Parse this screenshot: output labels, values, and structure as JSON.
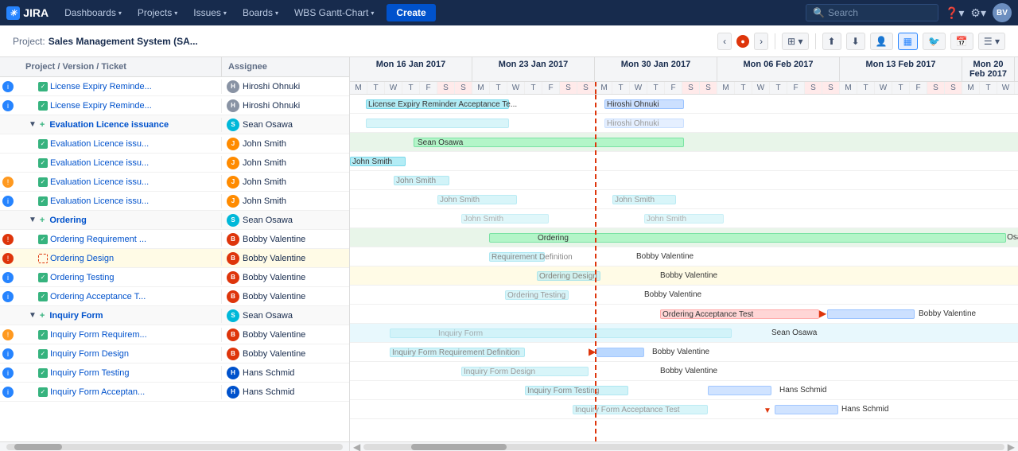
{
  "nav": {
    "logo": "JIRA",
    "menus": [
      "Dashboards",
      "Projects",
      "Issues",
      "Boards",
      "WBS Gantt-Chart"
    ],
    "create_label": "Create",
    "search_placeholder": "Search"
  },
  "subheader": {
    "project_label": "Project:",
    "project_name": "Sales Management System (SA...",
    "nav_prev": "‹",
    "nav_next": "›"
  },
  "columns": {
    "ticket": "Project / Version / Ticket",
    "assignee": "Assignee"
  },
  "weeks": [
    {
      "label": "Mon 16 Jan 2017",
      "days": 7
    },
    {
      "label": "Mon 23 Jan 2017",
      "days": 7
    },
    {
      "label": "Mon 30 Jan 2017",
      "days": 7
    },
    {
      "label": "Mon 06 Feb 2017",
      "days": 7
    },
    {
      "label": "Mon 13 Feb 2017",
      "days": 7
    },
    {
      "label": "Mon 20 Feb 2017",
      "days": 3
    }
  ],
  "days": [
    "M",
    "T",
    "W",
    "T",
    "F",
    "S",
    "S",
    "M",
    "T",
    "W",
    "T",
    "F",
    "S",
    "S",
    "M",
    "T",
    "W",
    "T",
    "F",
    "S",
    "S",
    "M",
    "T",
    "W",
    "T",
    "F",
    "S",
    "S",
    "M",
    "T",
    "W",
    "T",
    "F",
    "S",
    "S",
    "M",
    "T",
    "W"
  ],
  "rows": [
    {
      "id": 1,
      "indent": 2,
      "priority": "info",
      "checkbox": true,
      "name": "License Expiry Reminde...",
      "assignee": "Hiroshi Ohnuki",
      "av": "gray",
      "ticket_type": "T"
    },
    {
      "id": 2,
      "indent": 2,
      "priority": "info",
      "checkbox": true,
      "name": "License Expiry Reminde...",
      "assignee": "Hiroshi Ohnuki",
      "av": "gray",
      "ticket_type": "T"
    },
    {
      "id": 3,
      "indent": 1,
      "priority": null,
      "checkbox": false,
      "section": true,
      "expand": true,
      "name": "Evaluation Licence issuance",
      "assignee": "Sean Osawa",
      "av": "teal",
      "ticket_type": "In"
    },
    {
      "id": 4,
      "indent": 2,
      "priority": null,
      "checkbox": true,
      "name": "Evaluation Licence issu...",
      "assignee": "John Smith",
      "av": "orange",
      "ticket_type": "D"
    },
    {
      "id": 5,
      "indent": 2,
      "priority": null,
      "checkbox": true,
      "name": "Evaluation Licence issu...",
      "assignee": "John Smith",
      "av": "orange",
      "ticket_type": "D"
    },
    {
      "id": 6,
      "indent": 2,
      "priority": "warn",
      "checkbox": true,
      "name": "Evaluation Licence issu...",
      "assignee": "John Smith",
      "av": "orange",
      "ticket_type": "T"
    },
    {
      "id": 7,
      "indent": 2,
      "priority": "info",
      "checkbox": true,
      "name": "Evaluation Licence issu...",
      "assignee": "John Smith",
      "av": "orange",
      "ticket_type": "T"
    },
    {
      "id": 8,
      "indent": 1,
      "priority": null,
      "checkbox": false,
      "section": true,
      "expand": true,
      "name": "Ordering",
      "assignee": "Sean Osawa",
      "av": "teal",
      "ticket_type": "In"
    },
    {
      "id": 9,
      "indent": 2,
      "priority": "err",
      "checkbox": true,
      "name": "Ordering Requirement ...",
      "assignee": "Bobby Valentine",
      "av": "red",
      "ticket_type": "T"
    },
    {
      "id": 10,
      "indent": 2,
      "priority": "err",
      "checkbox": false,
      "highlighted": true,
      "name": "Ordering Design",
      "assignee": "Bobby Valentine",
      "av": "red",
      "ticket_type": "T"
    },
    {
      "id": 11,
      "indent": 2,
      "priority": "info",
      "checkbox": true,
      "name": "Ordering Testing",
      "assignee": "Bobby Valentine",
      "av": "red",
      "ticket_type": "T"
    },
    {
      "id": 12,
      "indent": 2,
      "priority": "info",
      "checkbox": true,
      "name": "Ordering Acceptance T...",
      "assignee": "Bobby Valentine",
      "av": "red",
      "ticket_type": "T"
    },
    {
      "id": 13,
      "indent": 1,
      "priority": null,
      "checkbox": false,
      "section": true,
      "expand": true,
      "name": "Inquiry Form",
      "assignee": "Sean Osawa",
      "av": "teal",
      "ticket_type": "T"
    },
    {
      "id": 14,
      "indent": 2,
      "priority": "warn",
      "checkbox": true,
      "name": "Inquiry Form Requirem...",
      "assignee": "Bobby Valentine",
      "av": "red",
      "ticket_type": "T"
    },
    {
      "id": 15,
      "indent": 2,
      "priority": "info",
      "checkbox": true,
      "name": "Inquiry Form Design",
      "assignee": "Bobby Valentine",
      "av": "red",
      "ticket_type": "T"
    },
    {
      "id": 16,
      "indent": 2,
      "priority": "info",
      "checkbox": true,
      "name": "Inquiry Form Testing",
      "assignee": "Hans Schmid",
      "av": "blue",
      "ticket_type": "T"
    },
    {
      "id": 17,
      "indent": 2,
      "priority": "info",
      "checkbox": true,
      "name": "Inquiry Form Acceptan...",
      "assignee": "Hans Schmid",
      "av": "blue",
      "ticket_type": "T"
    }
  ]
}
